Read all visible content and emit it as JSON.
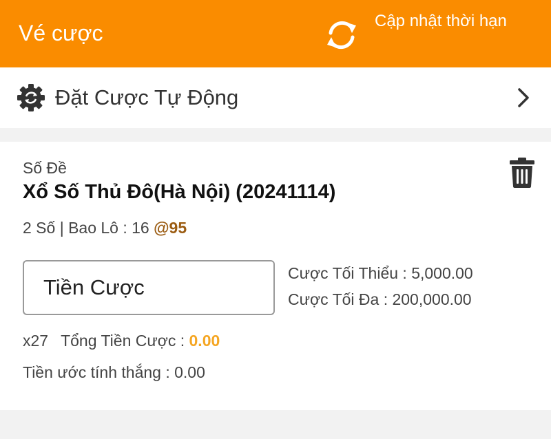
{
  "header": {
    "title": "Vé cược",
    "refresh_label": "Cập nhật thời hạn",
    "refresh_icon": "refresh-icon",
    "background_color": "#fa8c00"
  },
  "auto_bet": {
    "icon": "gear-icon",
    "label": "Đặt Cược Tự Động",
    "chevron_icon": "chevron-right-icon"
  },
  "bet_card": {
    "category": "Số Đề",
    "title": "Xổ Số Thủ Đô(Hà Nội) (20241114)",
    "detail_prefix": "2 Số | Bao Lô : 16",
    "odds": "@95",
    "odds_color": "#9b5c12",
    "delete_icon": "trash-icon",
    "stake_placeholder": "Tiền Cược",
    "min_stake": "Cược Tối Thiểu : 5,000.00",
    "max_stake": "Cược Tối Đa : 200,000.00",
    "multiplier": "x27",
    "total_label": "Tổng Tiền Cược :",
    "total_value": "0.00",
    "total_color": "#f5a623",
    "estimated_win": "Tiền ước tính thắng : 0.00"
  }
}
